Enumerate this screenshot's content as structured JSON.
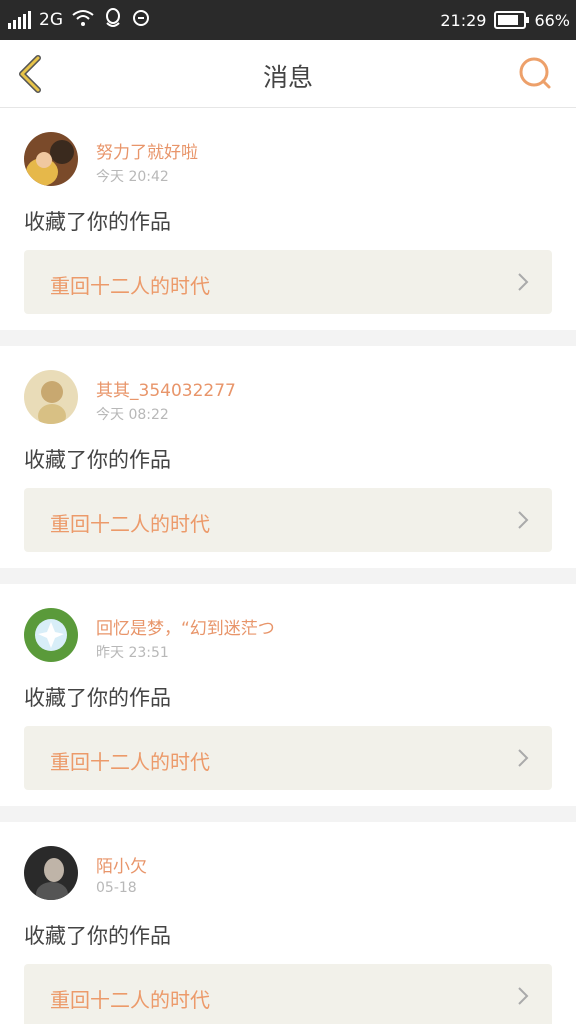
{
  "status_bar": {
    "network": "2G",
    "time": "21:29",
    "battery": "66%"
  },
  "header": {
    "title": "消息"
  },
  "colors": {
    "accent": "#e8956a",
    "back_arrow": "#e8c44a",
    "work_bg": "#f2f1ea"
  },
  "messages": [
    {
      "user": "努力了就好啦",
      "time": "今天 20:42",
      "action": "收藏了你的作品",
      "work_title": "重回十二人的时代"
    },
    {
      "user": "其其_354032277",
      "time": "今天 08:22",
      "action": "收藏了你的作品",
      "work_title": "重回十二人的时代"
    },
    {
      "user": "回忆是梦，“幻到迷茫つ",
      "time": "昨天 23:51",
      "action": "收藏了你的作品",
      "work_title": "重回十二人的时代"
    },
    {
      "user": "陌小欠",
      "time": "05-18",
      "action": "收藏了你的作品",
      "work_title": "重回十二人的时代"
    }
  ]
}
